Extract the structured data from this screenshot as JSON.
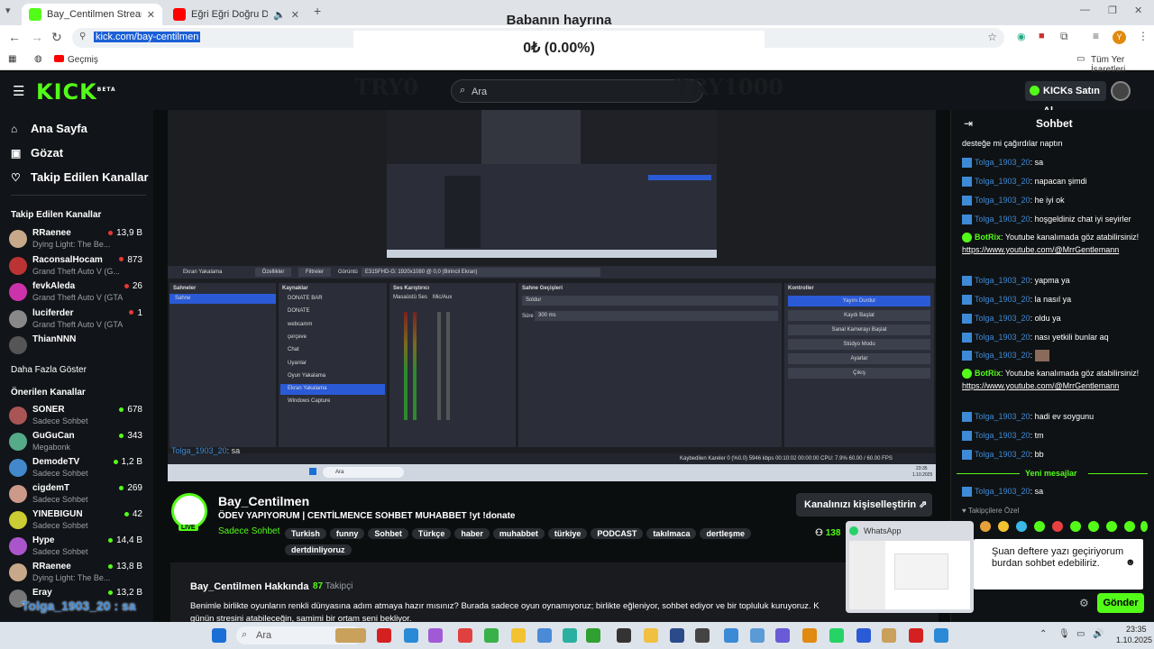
{
  "browser": {
    "tabs": [
      {
        "title": "Bay_Centilmen Stream - Watch",
        "active": true,
        "favicon_color": "#53fc18"
      },
      {
        "title": "Eğri Eğri Doğru Doğru - Yo",
        "active": false,
        "favicon_color": "#ff0000"
      }
    ],
    "url": "kick.com/bay-centilmen",
    "bookmark_first": "Geçmiş",
    "bookmark_right": "Tüm Yer İşaretleri",
    "profile_letter": "Y"
  },
  "overlay": {
    "title": "Babanın hayrına",
    "amount": "0₺ (0.00%)",
    "left_label": "TRY0",
    "right_label": "TRY1000"
  },
  "header": {
    "logo": "KICK",
    "logo_sup": "BETA",
    "search_placeholder": "Ara",
    "kicks_button": "KICKs Satın Al"
  },
  "sidebar": {
    "nav": [
      {
        "label": "Ana Sayfa",
        "icon": "home-icon"
      },
      {
        "label": "Gözat",
        "icon": "browse-icon"
      },
      {
        "label": "Takip Edilen Kanallar",
        "icon": "heart-icon"
      }
    ],
    "followed_title": "Takip Edilen Kanallar",
    "followed": [
      {
        "name": "RRaenee",
        "game": "Dying Light: The Be...",
        "viewers": "13,9 B",
        "color": "#c7a98a"
      },
      {
        "name": "RaconsalHocam",
        "game": "Grand Theft Auto V (G...",
        "viewers": "873",
        "color": "#b33"
      },
      {
        "name": "fevkAleda",
        "game": "Grand Theft Auto V (GTA)",
        "viewers": "26",
        "color": "#c3a"
      },
      {
        "name": "luciferder",
        "game": "Grand Theft Auto V (GTA)",
        "viewers": "1",
        "color": "#888"
      },
      {
        "name": "ThianNNN",
        "game": "",
        "viewers": "",
        "color": "#555"
      }
    ],
    "show_more": "Daha Fazla Göster",
    "recommended_title": "Önerilen Kanallar",
    "recommended": [
      {
        "name": "SONER",
        "game": "Sadece Sohbet",
        "viewers": "678",
        "color": "#a55"
      },
      {
        "name": "GuGuCan",
        "game": "Megabonk",
        "viewers": "343",
        "color": "#5a8"
      },
      {
        "name": "DemodeTV",
        "game": "Sadece Sohbet",
        "viewers": "1,2 B",
        "color": "#48c"
      },
      {
        "name": "cigdemT",
        "game": "Sadece Sohbet",
        "viewers": "269",
        "color": "#c98"
      },
      {
        "name": "YINEBIGUN",
        "game": "Sadece Sohbet",
        "viewers": "42",
        "color": "#cc3"
      },
      {
        "name": "Hype",
        "game": "Sadece Sohbet",
        "viewers": "14,4 B",
        "color": "#a5c"
      },
      {
        "name": "RRaenee",
        "game": "Dying Light: The Be...",
        "viewers": "13,8 B",
        "color": "#c7a98a"
      },
      {
        "name": "Eray",
        "game": "",
        "viewers": "13,2 B",
        "color": "#777"
      }
    ]
  },
  "video": {
    "obs": {
      "source_bar": {
        "screen_label": "Ekran Yakalama",
        "props": "Özellikler",
        "filters": "Filtreler",
        "display_label": "Görüntü",
        "display_value": "E315FHD-G: 1920x1080 @ 0,0 (Birincil Ekran)"
      },
      "scenes_title": "Sahneler",
      "scenes": [
        "Sahne"
      ],
      "sources_title": "Kaynaklar",
      "sources": [
        "DONATE BAR",
        "DONATE",
        "webcamm",
        "çerçeve",
        "Chat",
        "Uyarılar",
        "Oyun Yakalama",
        "Ekran Yakalama",
        "Windows Capture"
      ],
      "mixer_title": "Ses Karıştırıcı",
      "mixer": [
        "Masaüstü Ses",
        "Mic/Aux"
      ],
      "transitions_title": "Sahne Geçişleri",
      "transition": "Soldur",
      "duration_label": "Süre",
      "duration": "300 ms",
      "controls_title": "Kontroller",
      "controls": [
        "Yayını Durdur",
        "Kaydı Başlat",
        "Sanal Kamerayı Başlat",
        "Stüdyo Modu",
        "Ayarlar",
        "Çıkış"
      ],
      "status": "Kaybedilen Kareler 0 (%0.0)   5946 kbps   00:10:02   00:00:00   CPU: 7.9%   60.00 / 60.00 FPS"
    },
    "chat_overlay": {
      "user": "Tolga_1903_20",
      "text": ": sa"
    },
    "inner_taskbar": {
      "search": "Ara",
      "time": "23:35",
      "date": "1.10.2025"
    }
  },
  "stream": {
    "streamer": "Bay_Centilmen",
    "title": "ÖDEV YAPIYORUM | CENTİLMENCE SOHBET MUHABBET !yt !donate",
    "category": "Sadece Sohbet",
    "tags": [
      "Turkish",
      "funny",
      "Sohbet",
      "Türkçe",
      "haber",
      "muhabbet",
      "türkiye",
      "PODCAST",
      "takılmaca",
      "dertleşme",
      "dertdinliyoruz"
    ],
    "live_label": "LIVE",
    "customize_button": "Kanalınızı kişiselleştirin",
    "viewers_partial": "138"
  },
  "about": {
    "title": "Bay_Centilmen Hakkında",
    "followers": "87",
    "followers_label": "Takipçi",
    "text": "Benimle birlikte oyunların renkli dünyasına adım atmaya hazır mısınız? Burada sadece oyun oynamıyoruz; birlikte eğleniyor, sohbet ediyor ve bir topluluk kuruyoruz. K",
    "text2": "günün stresini atabileceğin, samimi bir ortam seni bekliyor.",
    "big_overlay": "Tolga_1903_20 : sa"
  },
  "chat": {
    "title": "Sohbet",
    "messages": [
      {
        "user": "",
        "text": "desteğe mi çağırdılar naptın"
      },
      {
        "user": "Tolga_1903_20",
        "text": "sa"
      },
      {
        "user": "Tolga_1903_20",
        "text": "napacan şimdi"
      },
      {
        "user": "Tolga_1903_20",
        "text": "he iyi ok"
      },
      {
        "user": "Tolga_1903_20",
        "text": "hoşgeldiniz chat iyi seyirler"
      },
      {
        "user": "BotRix",
        "text": "Youtube kanalımada göz atabilirsiniz!",
        "link": "https://www.youtube.com/@MrrGentlemann",
        "bot": true
      },
      {
        "user": "Tolga_1903_20",
        "text": "yapma ya"
      },
      {
        "user": "Tolga_1903_20",
        "text": "la nasıl ya"
      },
      {
        "user": "Tolga_1903_20",
        "text": "oldu ya"
      },
      {
        "user": "Tolga_1903_20",
        "text": "nası yetkili bunlar aq"
      },
      {
        "user": "Tolga_1903_20",
        "text": ""
      },
      {
        "user": "BotRix",
        "text": "Youtube kanalımada göz atabilirsiniz!",
        "link": "https://www.youtube.com/@MrrGentlemann",
        "bot": true
      },
      {
        "user": "Tolga_1903_20",
        "text": "hadi ev soygunu"
      },
      {
        "user": "Tolga_1903_20",
        "text": "tm"
      },
      {
        "user": "Tolga_1903_20",
        "text": "bb"
      }
    ],
    "new_messages": "Yeni mesajlar",
    "last_message": {
      "user": "Tolga_1903_20",
      "text": "sa"
    },
    "followers_only": "Takipçilere Özel",
    "send_button": "Gönder"
  },
  "whatsapp": {
    "app": "WhatsApp",
    "toast_text": "Şuan deftere yazı geçiriyorum burdan sohbet edebiliriz."
  },
  "taskbar": {
    "search": "Ara",
    "time": "23:35",
    "date": "1.10.2025"
  },
  "colors": {
    "kick_green": "#53fc18",
    "chat_user": "#3d8ad6",
    "obs_blue": "#2a5ad6"
  }
}
